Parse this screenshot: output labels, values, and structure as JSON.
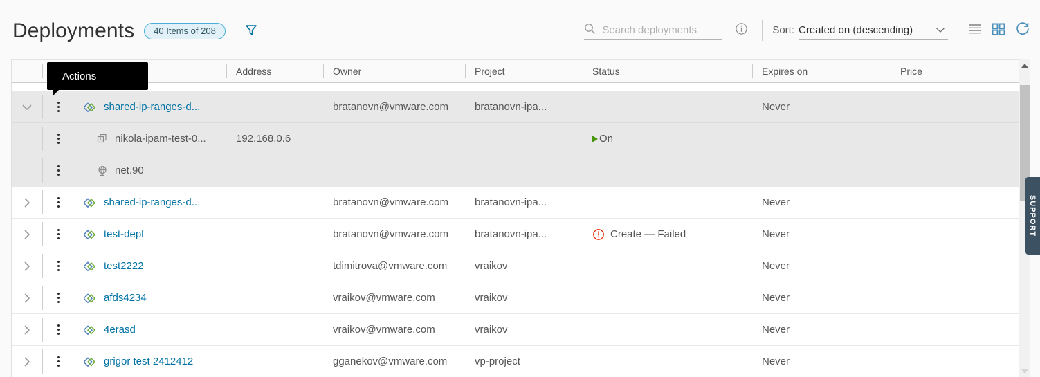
{
  "header": {
    "title": "Deployments",
    "count_badge": "40 Items of 208",
    "filter_icon": "filter-icon",
    "search": {
      "icon": "search-icon",
      "placeholder": "Search deployments",
      "value": "",
      "info_icon": "info-circle-icon"
    },
    "sort": {
      "label": "Sort:",
      "value": "Created on (descending)",
      "chevron": "chevron-down-icon"
    },
    "view_icons": [
      {
        "name": "list-view-icon",
        "active": false
      },
      {
        "name": "card-view-icon",
        "active": true
      },
      {
        "name": "refresh-icon",
        "active": true
      }
    ]
  },
  "tooltip": {
    "text": "Actions"
  },
  "table": {
    "columns": [
      {
        "key": "expand",
        "label": ""
      },
      {
        "key": "actions",
        "label": ""
      },
      {
        "key": "name",
        "label": ""
      },
      {
        "key": "address",
        "label": "Address"
      },
      {
        "key": "owner",
        "label": "Owner"
      },
      {
        "key": "project",
        "label": "Project"
      },
      {
        "key": "status",
        "label": "Status"
      },
      {
        "key": "expires",
        "label": "Expires on"
      },
      {
        "key": "price",
        "label": "Price"
      }
    ],
    "rows": [
      {
        "expanded": true,
        "highlighted": true,
        "icon": "deployment-icon",
        "name": "shared-ip-ranges-d...",
        "address": "",
        "owner": "bratanovn@vmware.com",
        "project": "bratanovn-ipa...",
        "status": "",
        "status_type": "none",
        "expires": "Never",
        "price": "",
        "children": [
          {
            "icon": "virtual-machine-icon",
            "name": "nikola-ipam-test-0...",
            "address": "192.168.0.6",
            "owner": "",
            "project": "",
            "status": "On",
            "status_type": "on",
            "expires": "",
            "price": ""
          },
          {
            "icon": "network-icon",
            "name": "net.90",
            "address": "",
            "owner": "",
            "project": "",
            "status": "",
            "status_type": "none",
            "expires": "",
            "price": ""
          }
        ]
      },
      {
        "expanded": false,
        "highlighted": false,
        "icon": "deployment-icon",
        "name": "shared-ip-ranges-d...",
        "address": "",
        "owner": "bratanovn@vmware.com",
        "project": "bratanovn-ipa...",
        "status": "",
        "status_type": "none",
        "expires": "Never",
        "price": "",
        "children": []
      },
      {
        "expanded": false,
        "highlighted": false,
        "icon": "deployment-icon",
        "name": "test-depl",
        "address": "",
        "owner": "bratanovn@vmware.com",
        "project": "bratanovn-ipa...",
        "status": "Create — Failed",
        "status_type": "failed",
        "expires": "Never",
        "price": "",
        "children": []
      },
      {
        "expanded": false,
        "highlighted": false,
        "icon": "deployment-icon",
        "name": "test2222",
        "address": "",
        "owner": "tdimitrova@vmware.com",
        "project": "vraikov",
        "status": "",
        "status_type": "none",
        "expires": "Never",
        "price": "",
        "children": []
      },
      {
        "expanded": false,
        "highlighted": false,
        "icon": "deployment-icon",
        "name": "afds4234",
        "address": "",
        "owner": "vraikov@vmware.com",
        "project": "vraikov",
        "status": "",
        "status_type": "none",
        "expires": "Never",
        "price": "",
        "children": []
      },
      {
        "expanded": false,
        "highlighted": false,
        "icon": "deployment-icon",
        "name": "4erasd",
        "address": "",
        "owner": "vraikov@vmware.com",
        "project": "vraikov",
        "status": "",
        "status_type": "none",
        "expires": "Never",
        "price": "",
        "children": []
      },
      {
        "expanded": false,
        "highlighted": false,
        "icon": "deployment-icon",
        "name": "grigor test 2412412",
        "address": "",
        "owner": "gganekov@vmware.com",
        "project": "vp-project",
        "status": "",
        "status_type": "none",
        "expires": "Never",
        "price": "",
        "children": []
      }
    ]
  },
  "support_tab": {
    "label": "SUPPORT"
  },
  "colors": {
    "accent_blue": "#0072a3",
    "badge_border": "#49afd9",
    "badge_bg": "#e1f1f7",
    "status_on_green": "#48960c",
    "status_failed_red": "#e62700",
    "row_highlight": "#e8e8e8",
    "support_tab": "#3c5162"
  }
}
